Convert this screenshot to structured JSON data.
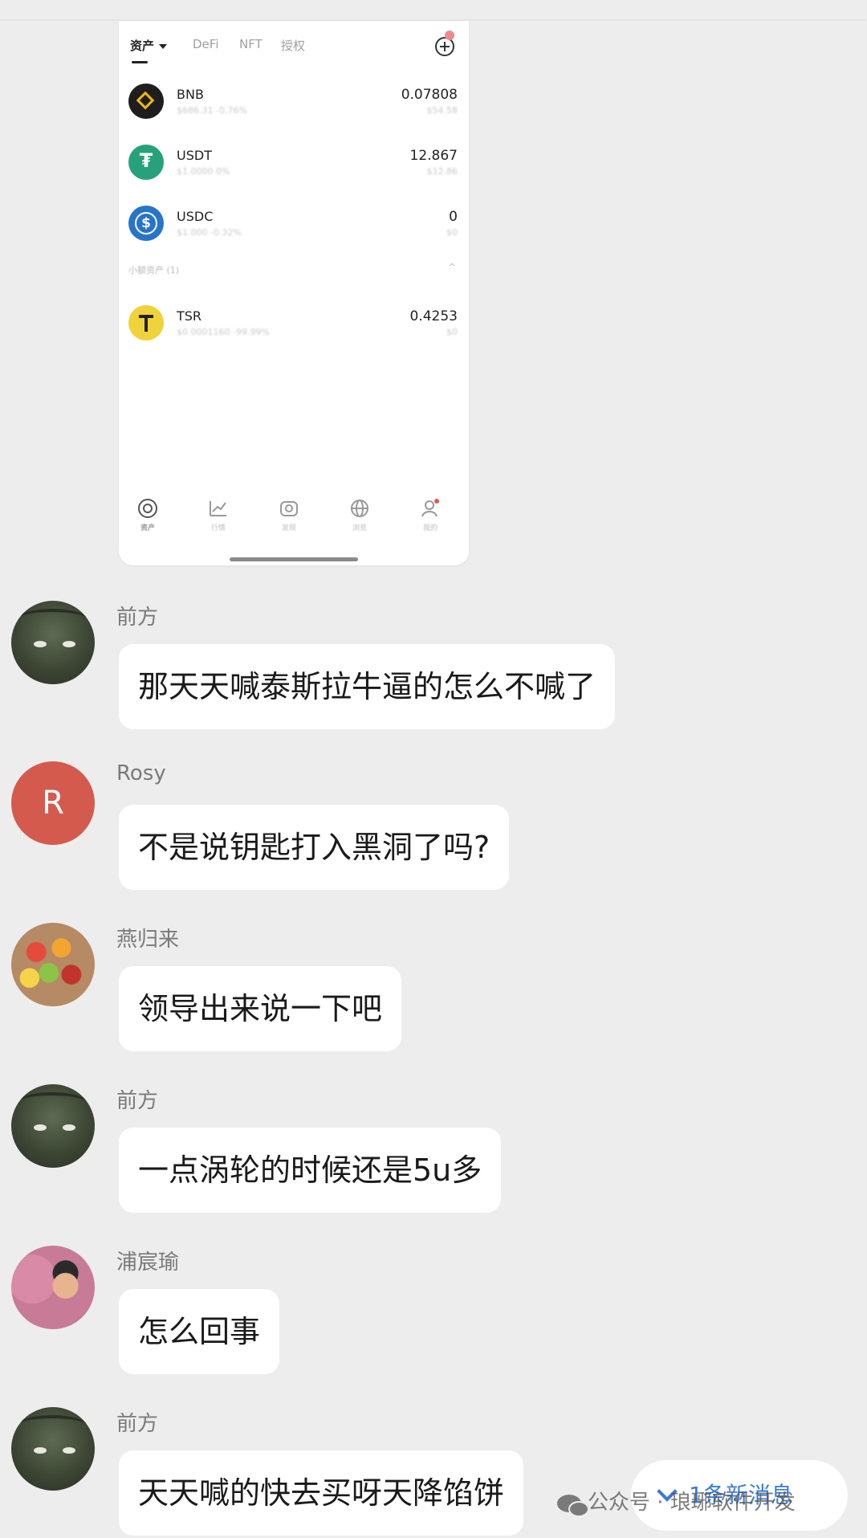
{
  "wallet": {
    "tabs": [
      "资产",
      "DeFi",
      "NFT",
      "授权"
    ],
    "assets": [
      {
        "symbol": "BNB",
        "price_change": "$686.31 -0.76%",
        "amount": "0.07808",
        "value": "$54.58",
        "icon": "bnb-icon"
      },
      {
        "symbol": "USDT",
        "price_change": "$1.0000 0%",
        "amount": "12.867",
        "value": "$12.86",
        "icon": "usdt-icon"
      },
      {
        "symbol": "USDC",
        "price_change": "$1.000 -0.32%",
        "amount": "0",
        "value": "$0",
        "icon": "usdc-icon"
      }
    ],
    "small_assets_label": "小额资产 (1)",
    "small_assets": [
      {
        "symbol": "TSR",
        "price_change": "$0.0001160 -99.99%",
        "amount": "0.4253",
        "value": "$0",
        "icon": "tsr-icon"
      }
    ],
    "nav": [
      "资产",
      "行情",
      "发现",
      "浏览",
      "我的"
    ]
  },
  "messages": [
    {
      "sender": "前方",
      "text": "那天天喊泰斯拉牛逼的怎么不喊了",
      "avatar": "swan-avatar"
    },
    {
      "sender": "Rosy",
      "text": "不是说钥匙打入黑洞了吗?",
      "avatar": "letter-avatar",
      "avatar_letter": "R"
    },
    {
      "sender": "燕归来",
      "text": "领导出来说一下吧",
      "avatar": "fruit-avatar"
    },
    {
      "sender": "前方",
      "text": "一点涡轮的时候还是5u多",
      "avatar": "swan-avatar"
    },
    {
      "sender": "浦宸瑜",
      "text": "怎么回事",
      "avatar": "person-avatar"
    },
    {
      "sender": "前方",
      "text": "天天喊的快去买呀天降馅饼",
      "avatar": "swan-avatar"
    }
  ],
  "new_messages_label": "1条新消息",
  "watermark": "公众号 · 琅琊软件开发",
  "colors": {
    "background": "#ededed",
    "bubble": "#ffffff",
    "link_blue": "#3a7bd5"
  }
}
